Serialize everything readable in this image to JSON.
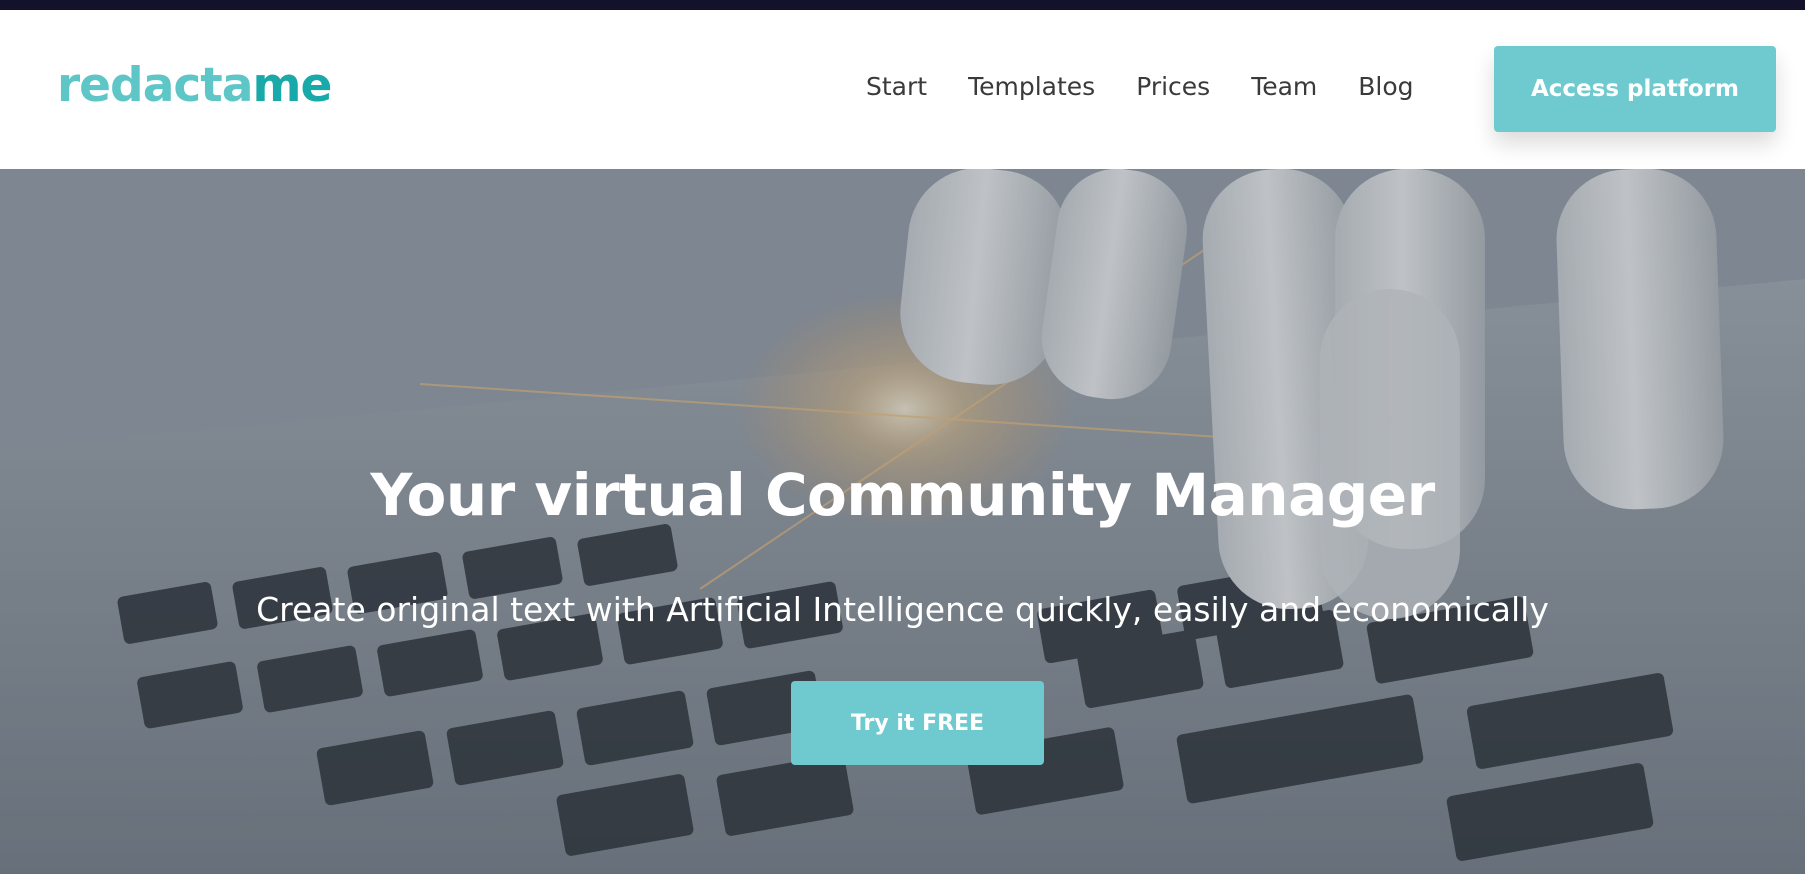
{
  "brand": {
    "logo_prefix": "redacta",
    "logo_suffix": "me",
    "primary_color": "#6ecacf",
    "logo_color": "#5ec6c6",
    "logo_accent_color": "#1aa9a9"
  },
  "nav": {
    "items": [
      {
        "label": "Start"
      },
      {
        "label": "Templates"
      },
      {
        "label": "Prices"
      },
      {
        "label": "Team"
      },
      {
        "label": "Blog"
      }
    ],
    "cta_label": "Access platform"
  },
  "hero": {
    "title": "Your virtual Community Manager",
    "subtitle": "Create original text with Artificial Intelligence quickly, easily and economically",
    "cta_label": "Try it FREE",
    "image": "robot-hand-typing-on-laptop-keyboard"
  }
}
